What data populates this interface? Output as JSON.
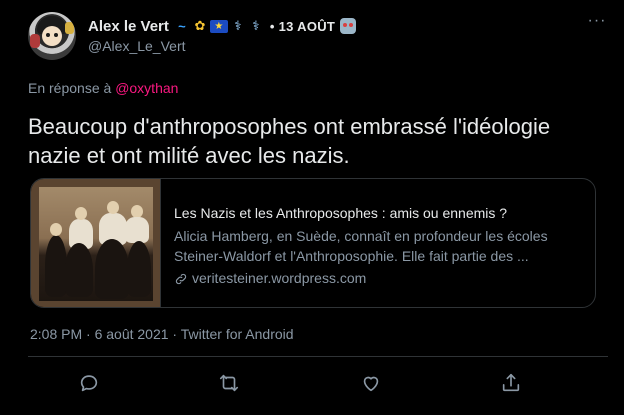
{
  "author": {
    "name": "Alex le Vert",
    "handle": "@Alex_Le_Vert",
    "badges": [
      "wave-icon",
      "sunflower-icon",
      "eu-flag-icon",
      "syringe-icon",
      "syringe-icon"
    ],
    "badge_glyphs": [
      "~",
      "✿",
      "★",
      "⚕",
      "⚕"
    ],
    "date_label": "• 13 AOÛT",
    "more_glyph": "···"
  },
  "reply": {
    "prefix": "En réponse à",
    "mention": "@oxythan"
  },
  "tweet": {
    "text": "Beaucoup d'anthroposophes ont embrassé l'idéologie nazie et ont milité avec les nazis."
  },
  "card": {
    "title": "Les Nazis et les Anthroposophes : amis ou ennemis ?",
    "description_line1": "Alicia Hamberg, en Suède, connaît en profondeur les écoles",
    "description_line2": "Steiner-Waldorf et l'Anthroposophie. Elle fait partie des ...",
    "domain": "veritesteiner.wordpress.com"
  },
  "meta": {
    "timestamp": "2:08 PM · 6 août 2021 · Twitter for Android"
  },
  "colors": {
    "background": "#000000",
    "text": "#e7e9ea",
    "secondary": "#8b98a5",
    "mention": "#f91880",
    "border": "#2f3336"
  }
}
